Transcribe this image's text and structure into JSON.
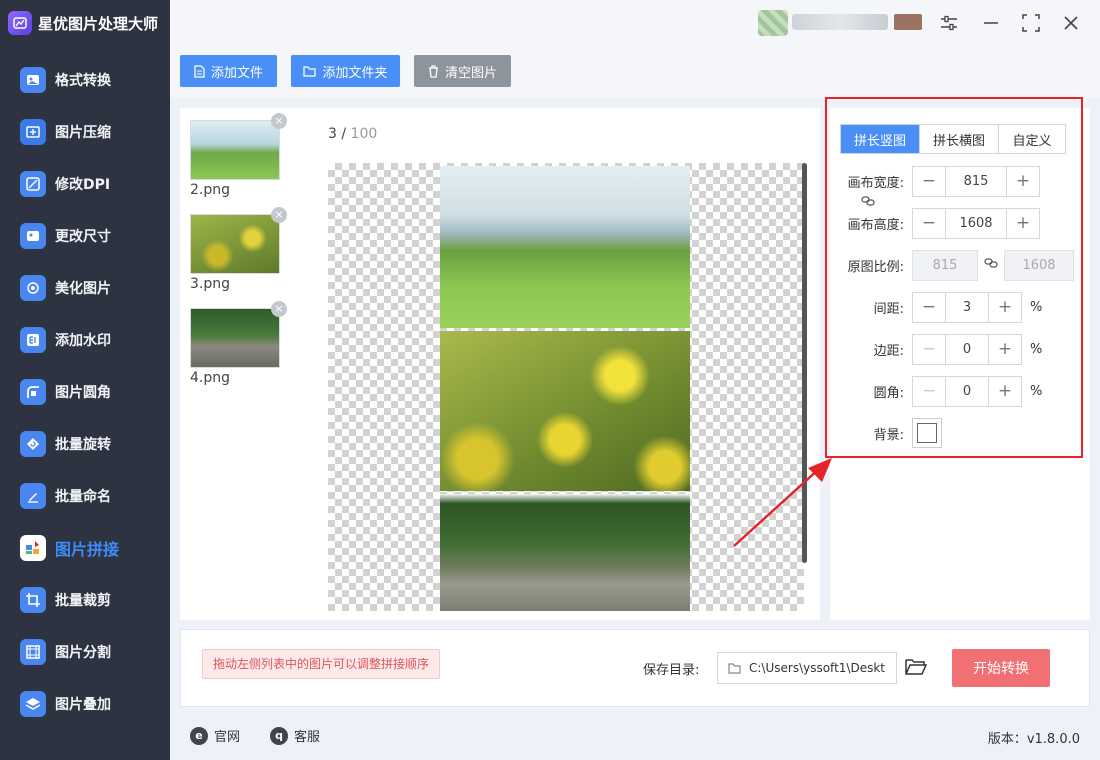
{
  "app": {
    "title": "星优图片处理大师"
  },
  "sidebar": {
    "items": [
      {
        "label": "格式转换",
        "icon": "image-format-icon"
      },
      {
        "label": "图片压缩",
        "icon": "compress-icon"
      },
      {
        "label": "修改DPI",
        "icon": "dpi-icon"
      },
      {
        "label": "更改尺寸",
        "icon": "resize-icon"
      },
      {
        "label": "美化图片",
        "icon": "beautify-icon"
      },
      {
        "label": "添加水印",
        "icon": "watermark-icon"
      },
      {
        "label": "图片圆角",
        "icon": "round-corner-icon"
      },
      {
        "label": "批量旋转",
        "icon": "rotate-icon"
      },
      {
        "label": "批量命名",
        "icon": "rename-icon"
      },
      {
        "label": "图片拼接",
        "icon": "stitch-icon",
        "active": true
      },
      {
        "label": "批量裁剪",
        "icon": "crop-icon"
      },
      {
        "label": "图片分割",
        "icon": "split-icon"
      },
      {
        "label": "图片叠加",
        "icon": "layers-icon"
      }
    ]
  },
  "toolbar": {
    "add_file": "添加文件",
    "add_folder": "添加文件夹",
    "clear_images": "清空图片"
  },
  "files": {
    "items": [
      {
        "name": "2.png"
      },
      {
        "name": "3.png"
      },
      {
        "name": "4.png"
      }
    ],
    "count": "3",
    "max": "100"
  },
  "settings": {
    "tabs": [
      "拼长竖图",
      "拼长横图",
      "自定义"
    ],
    "active_tab": "拼长竖图",
    "canvas_width_label": "画布宽度:",
    "canvas_width": "815",
    "canvas_height_label": "画布高度:",
    "canvas_height": "1608",
    "ratio_label": "原图比例:",
    "ratio_width": "815",
    "ratio_height": "1608",
    "spacing_label": "间距:",
    "spacing": "3",
    "margin_label": "边距:",
    "margin": "0",
    "radius_label": "圆角:",
    "radius": "0",
    "unit": "%",
    "background_label": "背景:",
    "background_color": "#ffffff"
  },
  "bottom": {
    "hint": "拖动左侧列表中的图片可以调整拼接顺序",
    "save_label": "保存目录:",
    "save_path": "C:\\Users\\yssoft1\\Deskt",
    "start_button": "开始转换"
  },
  "footer": {
    "website": "官网",
    "support": "客服",
    "version": "版本：v1.8.0.0"
  },
  "colors": {
    "accent": "#4a8ff5",
    "sidebar_bg": "#2d3340",
    "start_button": "#f07073",
    "highlight": "#e5232b"
  }
}
